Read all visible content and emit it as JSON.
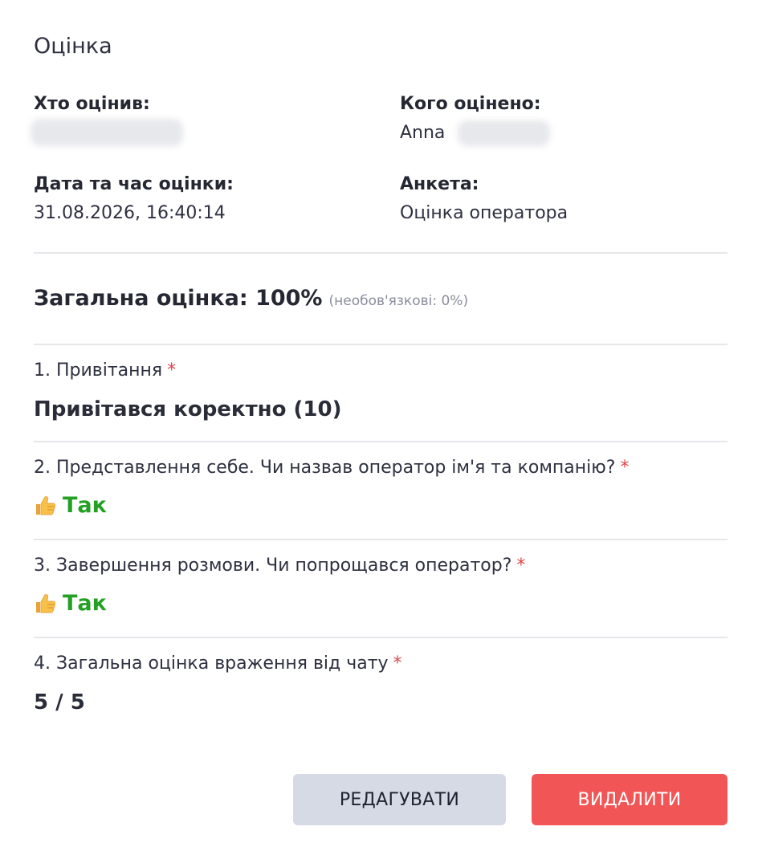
{
  "header": {
    "title": "Оцінка"
  },
  "info": {
    "evaluator_label": "Хто оцінив:",
    "evaluated_label": "Кого оцінено:",
    "evaluated_first_name": "Anna",
    "datetime_label": "Дата та час оцінки:",
    "datetime_value": "31.08.2026, 16:40:14",
    "form_label": "Анкета:",
    "form_value": "Оцінка оператора"
  },
  "overall": {
    "label": "Загальна оцінка: 100%",
    "optional_note": "(необов'язкові: 0%)"
  },
  "questions": [
    {
      "label": "1. Привітання",
      "required": "*",
      "answer": "Привітався коректно (10)"
    },
    {
      "label": "2. Представлення себе. Чи назвав оператор ім'я та компанію?",
      "required": "*",
      "answer": "Так",
      "icon": "thumbs-up-icon"
    },
    {
      "label": "3. Завершення розмови. Чи попрощався оператор?",
      "required": "*",
      "answer": "Так",
      "icon": "thumbs-up-icon"
    },
    {
      "label": "4. Загальна оцінка враження від чату",
      "required": "*",
      "answer": "5 / 5"
    }
  ],
  "actions": {
    "edit_label": "РЕДАГУВАТИ",
    "delete_label": "ВИДАЛИТИ"
  },
  "colors": {
    "yes": "#24a024",
    "required": "#e0454a",
    "delete": "#f25556",
    "edit": "#d6dae5"
  }
}
